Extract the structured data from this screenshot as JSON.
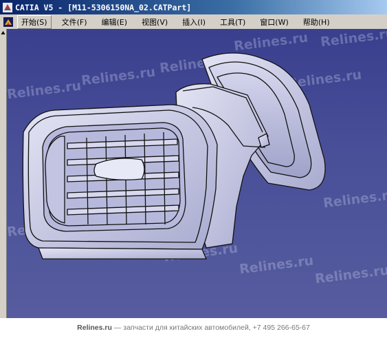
{
  "window": {
    "title": "CATIA V5 - [M11-5306150NA_02.CATPart]"
  },
  "menubar": {
    "items": [
      {
        "label": "开始(S)",
        "active": true
      },
      {
        "label": "文件(F)"
      },
      {
        "label": "编辑(E)"
      },
      {
        "label": "视图(V)"
      },
      {
        "label": "插入(I)"
      },
      {
        "label": "工具(T)"
      },
      {
        "label": "窗口(W)"
      },
      {
        "label": "帮助(H)"
      }
    ]
  },
  "watermark": {
    "text": "Relines.ru"
  },
  "footer": {
    "brand": "Relines.ru",
    "text": " — запчасти для китайских автомобилей, +7 495 266-65-67"
  },
  "icons": {
    "app": "catia-app-icon",
    "menu": "catia-menu-icon",
    "scroll_up": "arrow-up-icon"
  },
  "colors": {
    "viewport_bg": "#4a5098",
    "part_fill": "#c9cbe6",
    "titlebar": "#0a246a"
  }
}
